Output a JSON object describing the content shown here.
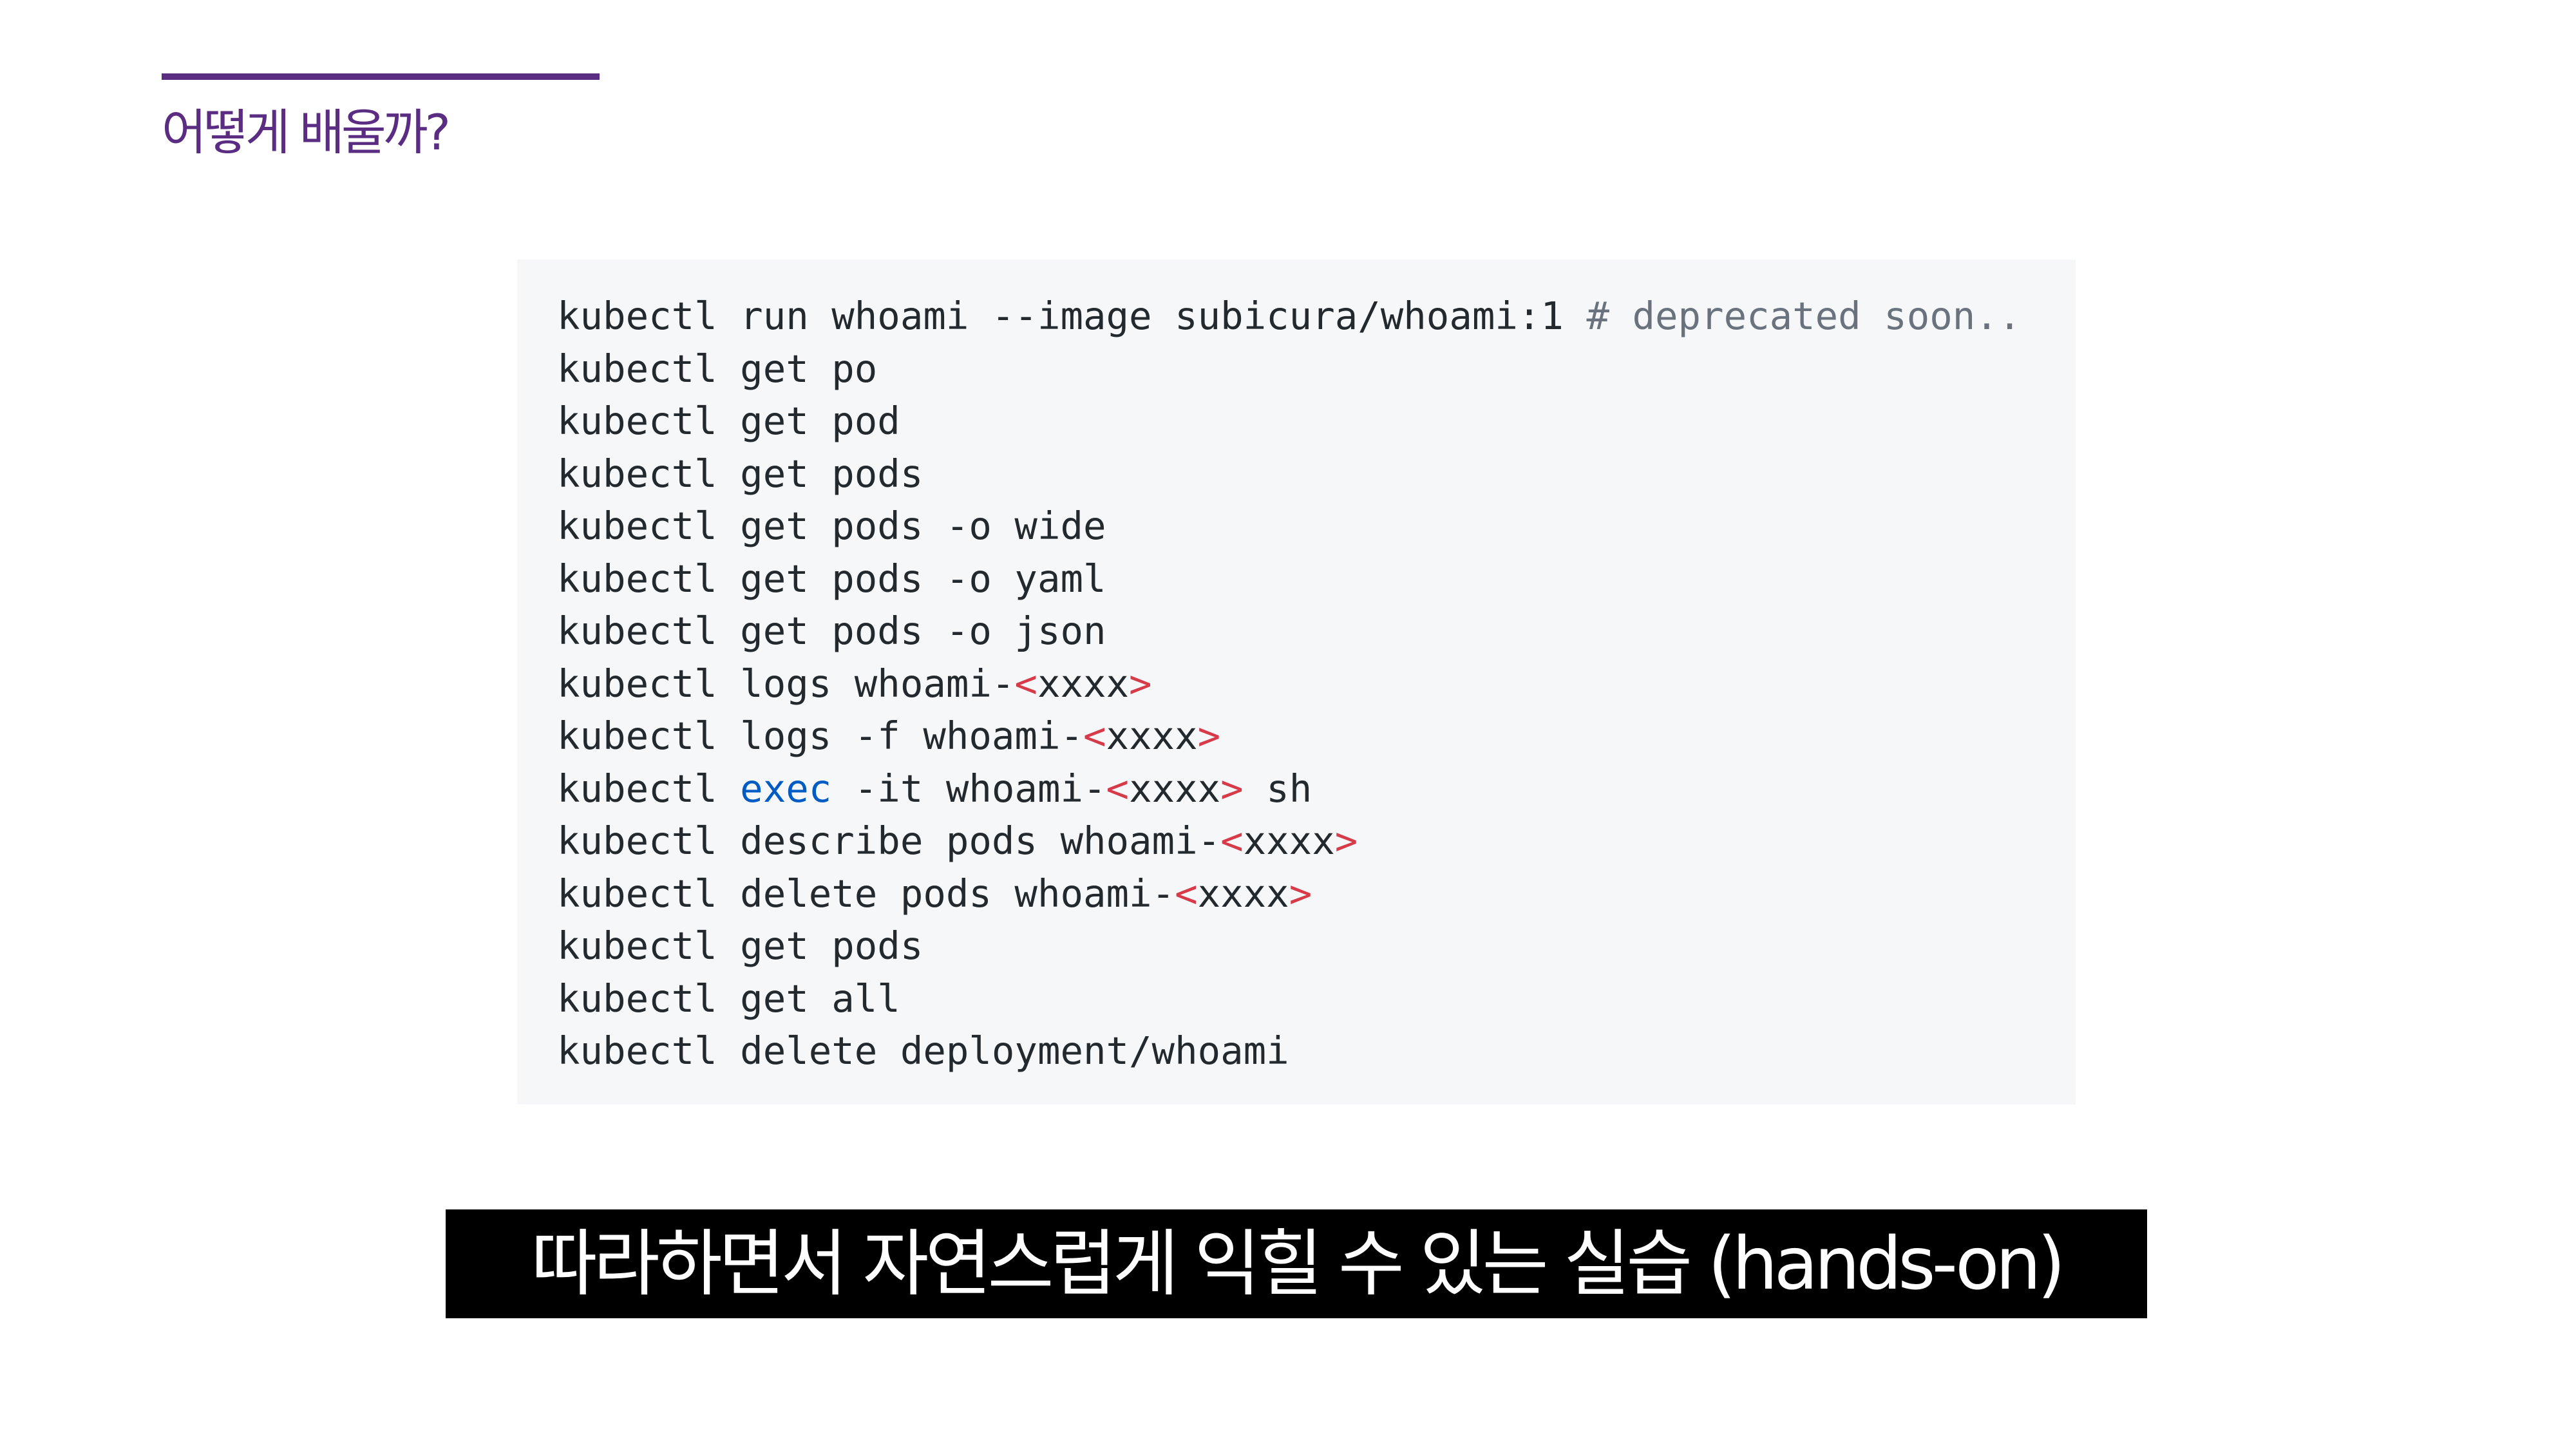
{
  "slide": {
    "title": "어떻게 배울까?",
    "accent_color": "#5b2d82"
  },
  "code": {
    "background": "#f6f7f9",
    "lines": [
      [
        {
          "t": "kubectl run whoami --image subicura/whoami:1 ",
          "c": "plain"
        },
        {
          "t": "# deprecated soon..",
          "c": "comment"
        }
      ],
      [
        {
          "t": "kubectl get po",
          "c": "plain"
        }
      ],
      [
        {
          "t": "kubectl get pod",
          "c": "plain"
        }
      ],
      [
        {
          "t": "kubectl get pods",
          "c": "plain"
        }
      ],
      [
        {
          "t": "kubectl get pods -o wide",
          "c": "plain"
        }
      ],
      [
        {
          "t": "kubectl get pods -o yaml",
          "c": "plain"
        }
      ],
      [
        {
          "t": "kubectl get pods -o json",
          "c": "plain"
        }
      ],
      [
        {
          "t": "kubectl logs whoami-",
          "c": "plain"
        },
        {
          "t": "<",
          "c": "angle"
        },
        {
          "t": "xxxx",
          "c": "plain"
        },
        {
          "t": ">",
          "c": "angle"
        }
      ],
      [
        {
          "t": "kubectl logs -f whoami-",
          "c": "plain"
        },
        {
          "t": "<",
          "c": "angle"
        },
        {
          "t": "xxxx",
          "c": "plain"
        },
        {
          "t": ">",
          "c": "angle"
        }
      ],
      [
        {
          "t": "kubectl ",
          "c": "plain"
        },
        {
          "t": "exec",
          "c": "keyword"
        },
        {
          "t": " -it whoami-",
          "c": "plain"
        },
        {
          "t": "<",
          "c": "angle"
        },
        {
          "t": "xxxx",
          "c": "plain"
        },
        {
          "t": ">",
          "c": "angle"
        },
        {
          "t": " sh",
          "c": "plain"
        }
      ],
      [
        {
          "t": "kubectl describe pods whoami-",
          "c": "plain"
        },
        {
          "t": "<",
          "c": "angle"
        },
        {
          "t": "xxxx",
          "c": "plain"
        },
        {
          "t": ">",
          "c": "angle"
        }
      ],
      [
        {
          "t": "kubectl delete pods whoami-",
          "c": "plain"
        },
        {
          "t": "<",
          "c": "angle"
        },
        {
          "t": "xxxx",
          "c": "plain"
        },
        {
          "t": ">",
          "c": "angle"
        }
      ],
      [
        {
          "t": "kubectl get pods",
          "c": "plain"
        }
      ],
      [
        {
          "t": "kubectl get all",
          "c": "plain"
        }
      ],
      [
        {
          "t": "kubectl delete deployment/whoami",
          "c": "plain"
        }
      ]
    ]
  },
  "caption": {
    "text": "따라하면서 자연스럽게 익힐 수 있는 실습 (hands-on)"
  }
}
